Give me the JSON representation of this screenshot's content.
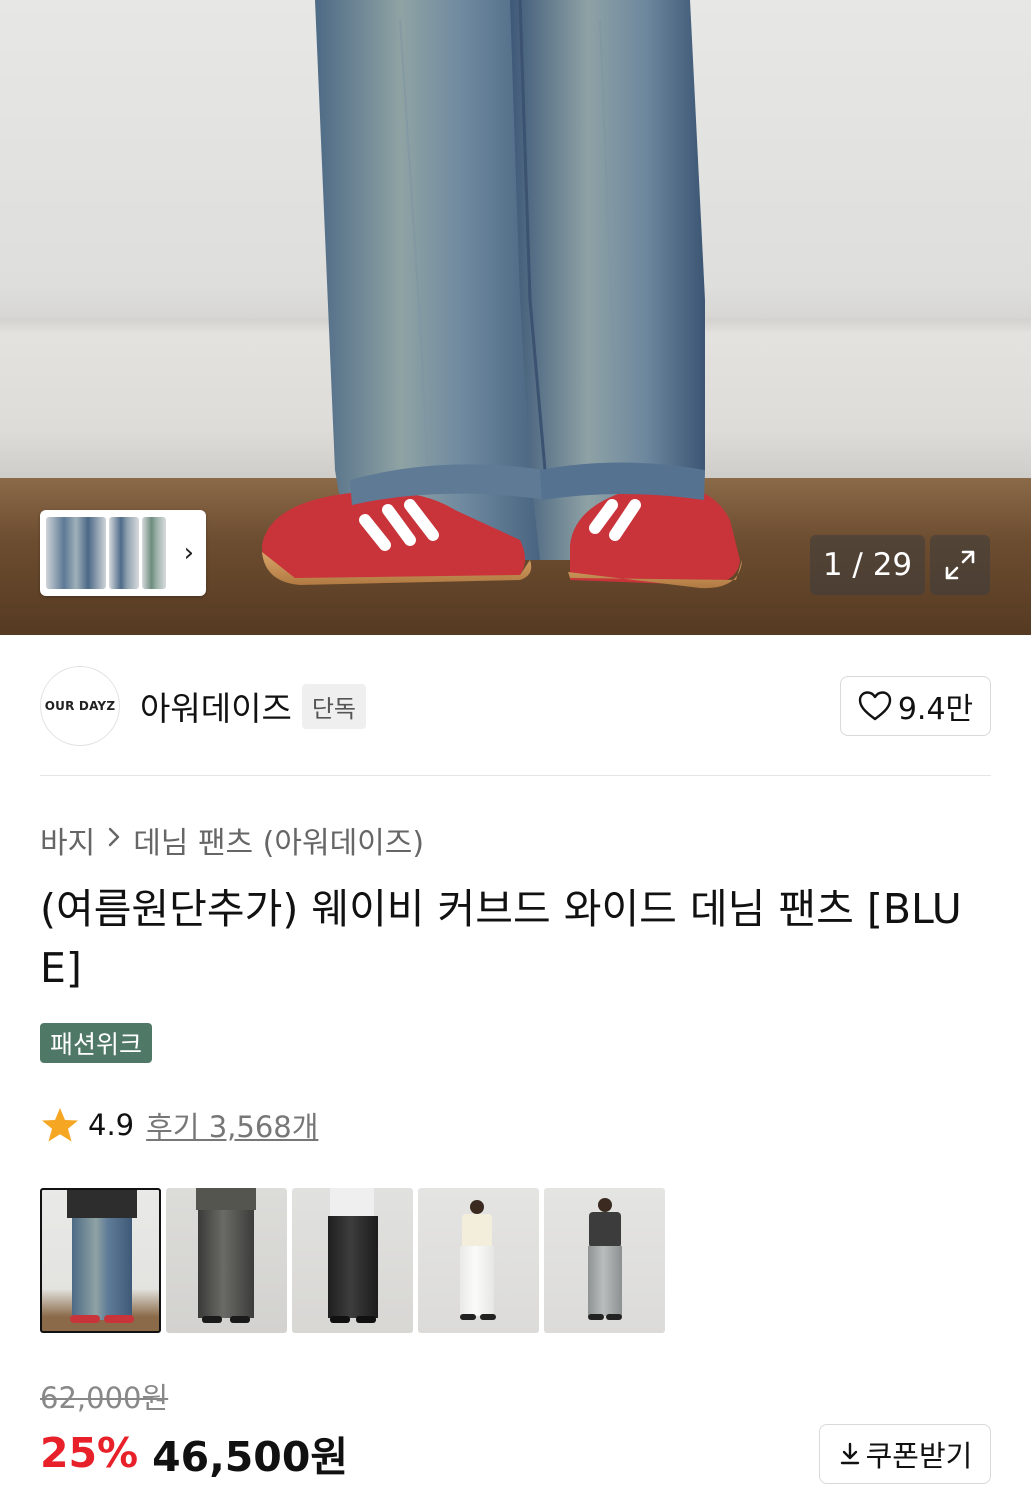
{
  "gallery": {
    "counter": "1 / 29",
    "thumb_strip_next_icon": "chevron-right-icon",
    "expand_icon": "expand-arrows-icon"
  },
  "brand": {
    "logo_text": "OUR DAYZ",
    "name": "아워데이즈",
    "badge": "단독",
    "likes": "9.4만",
    "like_icon": "heart-outline-icon"
  },
  "breadcrumb": {
    "items": [
      "바지",
      "데님 팬츠 (아워데이즈)"
    ],
    "separator_icon": "chevron-right-icon"
  },
  "product": {
    "title": "(여름원단추가) 웨이비 커브드 와이드 데님 팬츠 [BLUE]",
    "tag": "패션위크"
  },
  "rating": {
    "score": "4.9",
    "reviews": "후기 3,568개",
    "star_color": "#f5a623"
  },
  "variants": [
    {
      "label": "blue",
      "selected": true
    },
    {
      "label": "dark-gray",
      "selected": false
    },
    {
      "label": "black",
      "selected": false
    },
    {
      "label": "white",
      "selected": false
    },
    {
      "label": "light-gray",
      "selected": false
    }
  ],
  "price": {
    "original": "62,000원",
    "discount": "25%",
    "sale": "46,500원",
    "discount_color": "#e8202a"
  },
  "coupon": {
    "label": "쿠폰받기",
    "icon": "download-arrow-icon"
  }
}
